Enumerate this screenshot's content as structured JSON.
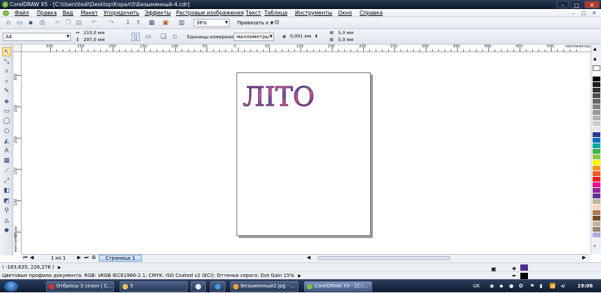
{
  "window": {
    "title": "CorelDRAW X5 - [C:\\Users\\tedi\\Desktop\\Корал\\5\\Безымянный-4.cdr]",
    "minimize": "–",
    "maximize": "□",
    "close": "✕"
  },
  "menu": [
    "Файл",
    "Правка",
    "Вид",
    "Макет",
    "Упорядочить",
    "Эффекты",
    "Растровые изображения",
    "Текст",
    "Таблица",
    "Инструменты",
    "Окно",
    "Справка"
  ],
  "mdi_controls": [
    "–",
    "□",
    "✕"
  ],
  "toolbar": {
    "zoom": "38%",
    "snap": "Привязать к"
  },
  "properties": {
    "paper_size": "A4",
    "width": "210,0 мм",
    "height": "297,0 мм",
    "units_label": "Единицы измерения:",
    "units": "миллиметры",
    "nudge": "0,001 мм",
    "dup_x": "5,0 мм",
    "dup_y": "5,0 мм"
  },
  "ruler": {
    "h_labels": [
      "300",
      "250",
      "200",
      "150",
      "100",
      "50",
      "0",
      "50",
      "100",
      "150",
      "200",
      "250",
      "300",
      "350",
      "400",
      "450",
      "500"
    ],
    "h_unit": "миллиметры",
    "v_labels": [
      "300",
      "250",
      "200",
      "150",
      "100",
      "50"
    ],
    "v_unit": "миллиметры"
  },
  "document": {
    "text": "ЛІТО"
  },
  "page_nav": {
    "counter": "1 из 1",
    "tab": "Страница 1"
  },
  "status": {
    "coords": "( -183,635; 226,276 )",
    "profiles": "Цветовые профили документа: RGB: sRGB IEC61966-2.1; CMYK: ISO Coated v2 (ECI); Оттенки серого: Dot Gain 15%"
  },
  "colors": {
    "accent": "#4a2e8f",
    "palette": [
      "#ffffff",
      "#000000",
      "#1a1a1a",
      "#333333",
      "#4d4d4d",
      "#666666",
      "#808080",
      "#999999",
      "#b3b3b3",
      "#cccccc",
      "#e6e6e6",
      "#2b3990",
      "#0072bc",
      "#00a99d",
      "#39b54a",
      "#8dc63f",
      "#fff200",
      "#f7941d",
      "#f15a24",
      "#ed1c24",
      "#ec008c",
      "#92278f",
      "#662d91",
      "#c2b59b",
      "#f9d6b5",
      "#a67c52",
      "#754c24",
      "#c7b299",
      "#998675",
      "#b9a9d6"
    ]
  },
  "taskbar": {
    "tasks": [
      "Отбросы 3 сезон | С...",
      "5",
      "",
      "Безымянный2.jpg - ...",
      "CorelDRAW X5 - [C:\\..."
    ],
    "lang": "UK",
    "time": "19:06"
  }
}
